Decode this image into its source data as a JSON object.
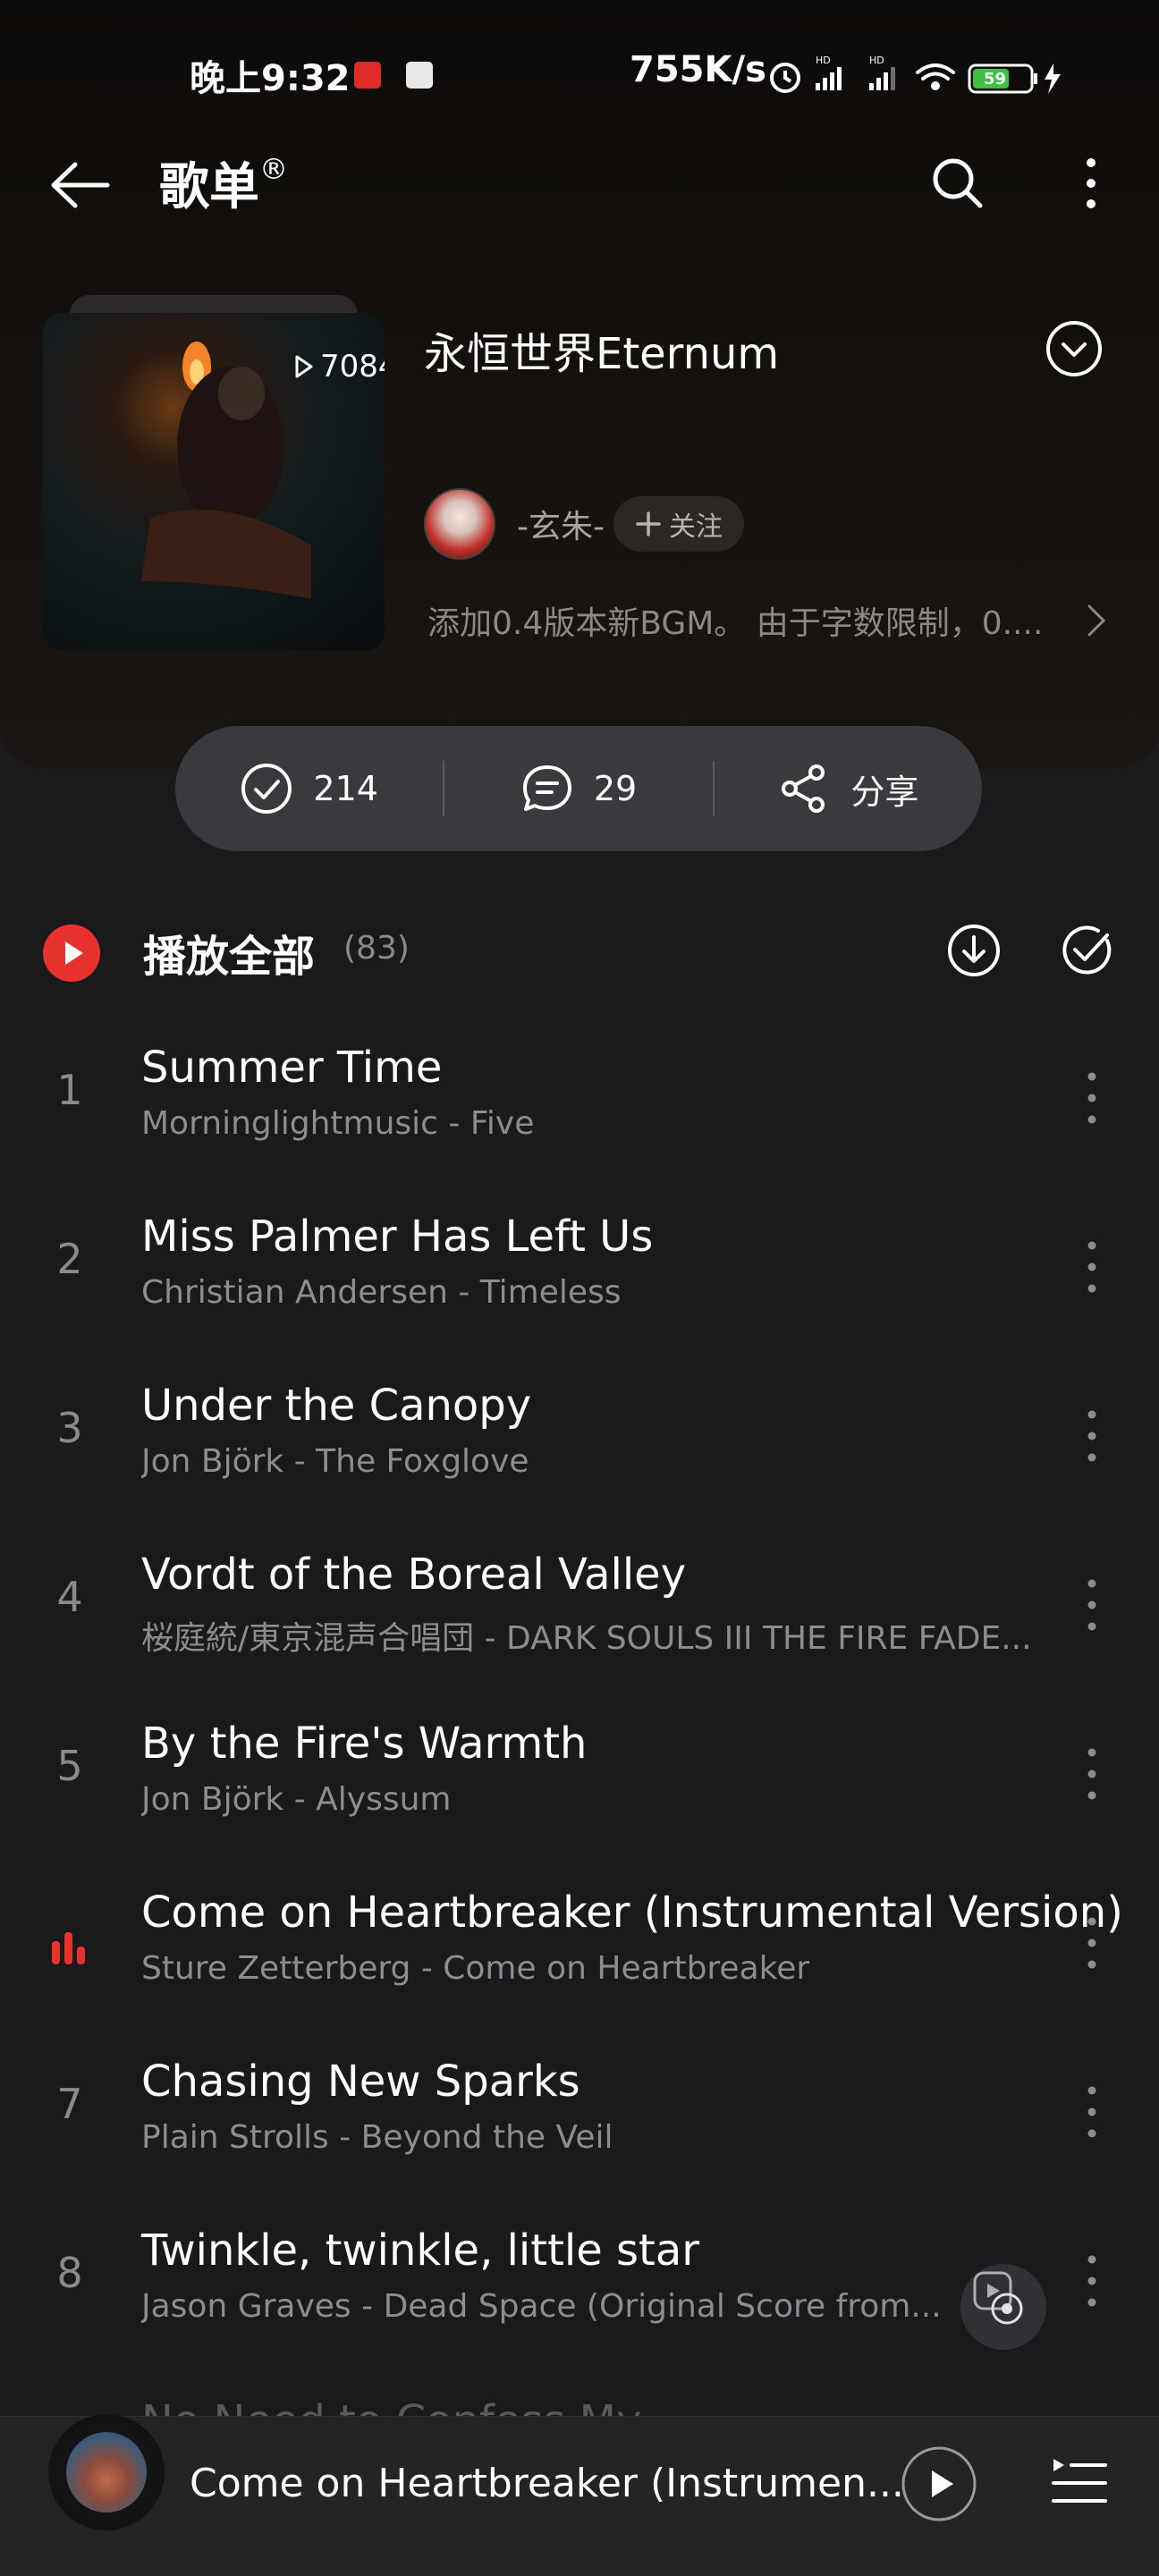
{
  "status_bar": {
    "time": "晚上9:32",
    "net_speed": "755K/s",
    "battery": "59"
  },
  "header": {
    "back_icon": "back-arrow-icon",
    "title": "歌单",
    "title_mark": "®",
    "search_icon": "search-icon",
    "more_icon": "more-vertical-icon"
  },
  "playlist": {
    "play_count": "7084",
    "title": "永恒世界Eternum",
    "creator": "-玄朱-",
    "follow_label": "关注",
    "description": "添加0.4版本新BGM。 由于字数限制，0...."
  },
  "actions": {
    "collect_count": "214",
    "comment_count": "29",
    "share_label": "分享"
  },
  "play_all": {
    "label": "播放全部",
    "count": "(83)"
  },
  "tracks": [
    {
      "num": "1",
      "title": "Summer Time",
      "sub": "Morninglightmusic - Five"
    },
    {
      "num": "2",
      "title": "Miss Palmer Has Left Us",
      "sub": "Christian Andersen - Timeless"
    },
    {
      "num": "3",
      "title": "Under the Canopy",
      "sub": "Jon Björk - The Foxglove"
    },
    {
      "num": "4",
      "title": "Vordt of the Boreal Valley",
      "sub": "桜庭統/東京混声合唱団 - DARK SOULS III THE FIRE FADE..."
    },
    {
      "num": "5",
      "title": "By the Fire's Warmth",
      "sub": "Jon Björk - Alyssum"
    },
    {
      "num": "",
      "title": "Come on Heartbreaker (Instrumental Version)",
      "sub": "Sture Zetterberg - Come on Heartbreaker",
      "playing": true
    },
    {
      "num": "7",
      "title": "Chasing New Sparks",
      "sub": "Plain Strolls - Beyond the Veil"
    },
    {
      "num": "8",
      "title": "Twinkle, twinkle, little star",
      "sub": "Jason Graves - Dead Space (Original Score from..."
    }
  ],
  "peek_title": "No Need to Confess My...",
  "mini_player": {
    "title": "Come on Heartbreaker (Instrumen..."
  },
  "colors": {
    "accent": "#e8322d",
    "background": "#1a1a1c",
    "action_bar": "#3a393d"
  }
}
